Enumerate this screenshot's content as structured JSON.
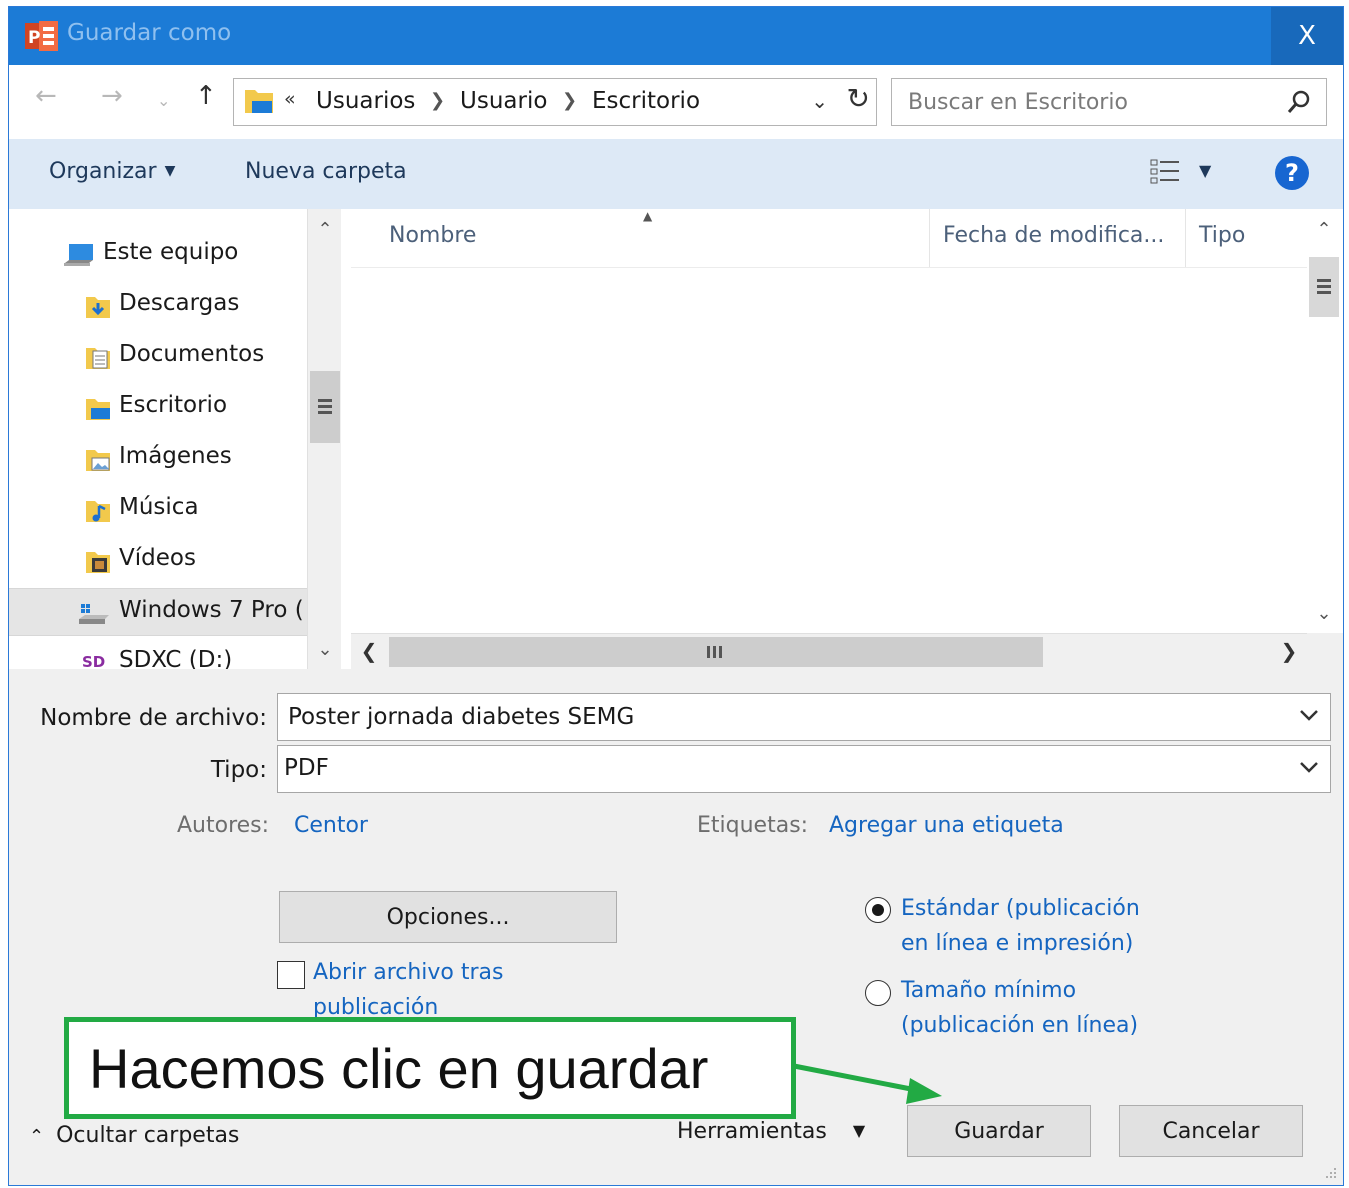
{
  "window": {
    "title": "Guardar como",
    "close_glyph": "X",
    "app_icon": "powerpoint-icon"
  },
  "address_bar": {
    "lead": "«",
    "crumbs": [
      "Usuarios",
      "Usuario",
      "Escritorio"
    ]
  },
  "search": {
    "placeholder": "Buscar en Escritorio"
  },
  "toolbar": {
    "organize": "Organizar",
    "new_folder": "Nueva carpeta"
  },
  "nav": {
    "items": [
      {
        "label": "Este equipo",
        "icon": "computer-icon"
      },
      {
        "label": "Descargas",
        "icon": "downloads-folder-icon"
      },
      {
        "label": "Documentos",
        "icon": "documents-folder-icon"
      },
      {
        "label": "Escritorio",
        "icon": "desktop-folder-icon"
      },
      {
        "label": "Imágenes",
        "icon": "pictures-folder-icon"
      },
      {
        "label": "Música",
        "icon": "music-folder-icon"
      },
      {
        "label": "Vídeos",
        "icon": "videos-folder-icon"
      },
      {
        "label": "Windows 7 Pro (",
        "icon": "drive-icon"
      },
      {
        "label": "SDXC (D:)",
        "icon": "sd-card-icon"
      }
    ]
  },
  "file_list": {
    "columns": [
      "Nombre",
      "Fecha de modifica...",
      "Tipo"
    ]
  },
  "form": {
    "filename_label": "Nombre de archivo:",
    "filename_value": "Poster jornada diabetes SEMG",
    "type_label": "Tipo:",
    "type_value": "PDF",
    "authors_label": "Autores:",
    "authors_value": "Centor",
    "tags_label": "Etiquetas:",
    "tags_value": "Agregar una etiqueta"
  },
  "options": {
    "options_button": "Opciones...",
    "open_after_line1": "Abrir archivo tras",
    "open_after_line2": "publicación",
    "open_after_checked": false,
    "standard_line1": "Estándar (publicación",
    "standard_line2": "en línea e impresión)",
    "minimum_line1": "Tamaño mínimo",
    "minimum_line2": "(publicación en línea)",
    "selected_option": "standard"
  },
  "footer": {
    "hide_folders": "Ocultar carpetas",
    "tools": "Herramientas",
    "save": "Guardar",
    "cancel": "Cancelar"
  },
  "annotation": {
    "text": "Hacemos clic en guardar",
    "border_color": "#22aa44"
  },
  "colors": {
    "titlebar": "#1c7bd6",
    "toolbar": "#dde9f6",
    "link": "#1565c0"
  }
}
